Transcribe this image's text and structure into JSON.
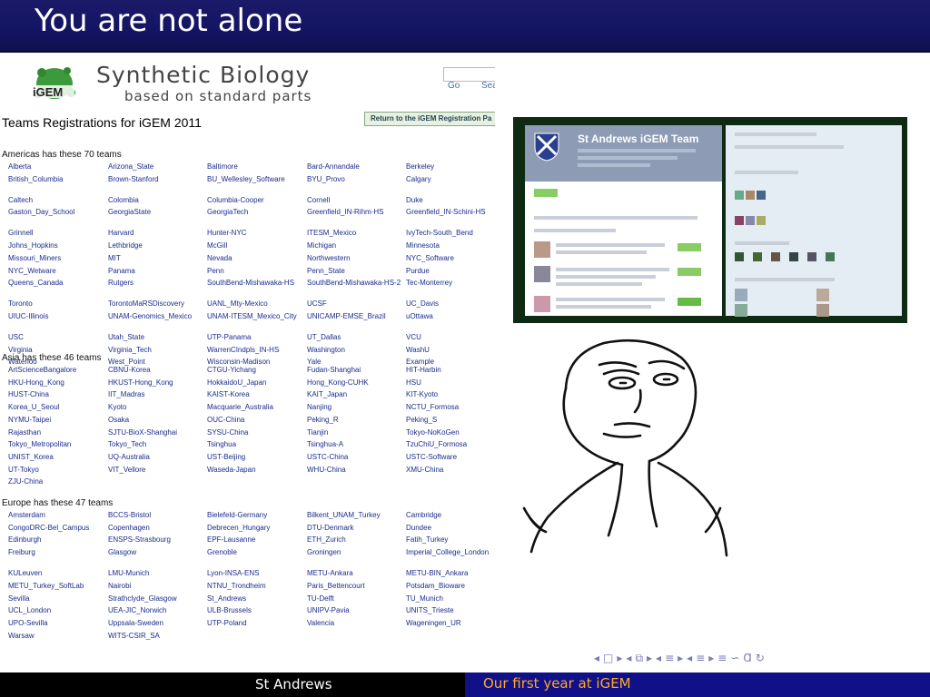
{
  "slide": {
    "title": "You are not alone"
  },
  "igem_page": {
    "logo_text": "iGEM",
    "header_title": "Synthetic Biology",
    "header_subtitle": "based on standard parts",
    "go_label": "Go",
    "search_label": "Sea",
    "registrations_title": "Teams Registrations for iGEM 2011",
    "return_button": "Return to the iGEM Registration Pa",
    "regions": [
      {
        "heading": "Americas has these 70 teams",
        "teams": [
          "Alberta",
          "Arizona_State",
          "Baltimore",
          "Bard-Annandale",
          "Berkeley",
          "British_Columbia",
          "Brown-Stanford",
          "BU_Wellesley_Software",
          "BYU_Provo",
          "Calgary",
          "Caltech",
          "Colombia",
          "Columbia-Cooper",
          "Cornell",
          "Duke",
          "Gaston_Day_School",
          "GeorgiaState",
          "GeorgiaTech",
          "Greenfield_IN-Rihm-HS",
          "Greenfield_IN-Schini-HS",
          "Grinnell",
          "Harvard",
          "Hunter-NYC",
          "ITESM_Mexico",
          "IvyTech-South_Bend",
          "Johns_Hopkins",
          "Lethbridge",
          "McGill",
          "Michigan",
          "Minnesota",
          "Missouri_Miners",
          "MIT",
          "Nevada",
          "Northwestern",
          "NYC_Software",
          "NYC_Wetware",
          "Panama",
          "Penn",
          "Penn_State",
          "Purdue",
          "Queens_Canada",
          "Rutgers",
          "SouthBend-Mishawaka-HS",
          "SouthBend-Mishawaka-HS-2",
          "Tec-Monterrey",
          "Toronto",
          "TorontoMaRSDiscovery",
          "UANL_Mty-Mexico",
          "UCSF",
          "UC_Davis",
          "UIUC-Illinois",
          "UNAM-Genomics_Mexico",
          "UNAM-ITESM_Mexico_City",
          "UNICAMP-EMSE_Brazil",
          "uOttawa",
          "USC",
          "Utah_State",
          "UTP-Panama",
          "UT_Dallas",
          "VCU",
          "Virginia",
          "Virginia_Tech",
          "WarrenCIndpls_IN-HS",
          "Washington",
          "WashU",
          "Waterloo",
          "West_Point",
          "Wisconsin-Madison",
          "Yale",
          "Example"
        ]
      },
      {
        "heading": "Asia has these 46 teams",
        "teams": [
          "ArtScienceBangalore",
          "CBNU-Korea",
          "CTGU-Yichang",
          "Fudan-Shanghai",
          "HIT-Harbin",
          "HKU-Hong_Kong",
          "HKUST-Hong_Kong",
          "HokkaidoU_Japan",
          "Hong_Kong-CUHK",
          "HSU",
          "HUST-China",
          "IIT_Madras",
          "KAIST-Korea",
          "KAIT_Japan",
          "KIT-Kyoto",
          "Korea_U_Seoul",
          "Kyoto",
          "Macquarie_Australia",
          "Nanjing",
          "NCTU_Formosa",
          "NYMU-Taipei",
          "Osaka",
          "OUC-China",
          "Peking_R",
          "Peking_S",
          "Rajasthan",
          "SJTU-BioX-Shanghai",
          "SYSU-China",
          "Tianjin",
          "Tokyo-NoKoGen",
          "Tokyo_Metropolitan",
          "Tokyo_Tech",
          "Tsinghua",
          "Tsinghua-A",
          "TzuChiU_Formosa",
          "UNIST_Korea",
          "UQ-Australia",
          "UST-Beijing",
          "USTC-China",
          "USTC-Software",
          "UT-Tokyo",
          "VIT_Vellore",
          "Waseda-Japan",
          "WHU-China",
          "XMU-China",
          "ZJU-China"
        ]
      },
      {
        "heading": "Europe has these 47 teams",
        "teams": [
          "Amsterdam",
          "BCCS-Bristol",
          "Bielefeld-Germany",
          "Bilkent_UNAM_Turkey",
          "Cambridge",
          "CongoDRC-Bel_Campus",
          "Copenhagen",
          "Debrecen_Hungary",
          "DTU-Denmark",
          "Dundee",
          "Edinburgh",
          "ENSPS-Strasbourg",
          "EPF-Lausanne",
          "ETH_Zurich",
          "Fatih_Turkey",
          "Freiburg",
          "Glasgow",
          "Grenoble",
          "Groningen",
          "Imperial_College_London",
          "KULeuven",
          "LMU-Munich",
          "Lyon-INSA-ENS",
          "METU-Ankara",
          "METU-BIN_Ankara",
          "METU_Turkey_SoftLab",
          "Nairobi",
          "NTNU_Trondheim",
          "Paris_Bettencourt",
          "Potsdam_Bioware",
          "Sevilla",
          "Strathclyde_Glasgow",
          "St_Andrews",
          "TU-Delft",
          "TU_Munich",
          "UCL_London",
          "UEA-JIC_Norwich",
          "ULB-Brussels",
          "UNIPV-Pavia",
          "UNITS_Trieste",
          "UPO-Sevilla",
          "Uppsala-Sweden",
          "UTP-Poland",
          "Valencia",
          "Wageningen_UR",
          "Warsaw",
          "WITS-CSIR_SA"
        ]
      }
    ]
  },
  "twitter": {
    "team_name": "St Andrews iGEM Team"
  },
  "nav_controls": [
    "◂",
    "□",
    "▸",
    "◂",
    "⧉",
    "▸",
    "◂",
    "≡",
    "▸",
    "◂",
    "≡",
    "▸",
    "≡",
    "∽",
    "Ɑ",
    "↻"
  ],
  "footer": {
    "left": "St Andrews",
    "right": "Our first year at iGEM"
  },
  "colors": {
    "title_bar": "#141464",
    "footer_left": "#000000",
    "footer_right": "#101088",
    "footer_right_text": "#ffaa22",
    "link_blue": "#1a2c8c"
  }
}
